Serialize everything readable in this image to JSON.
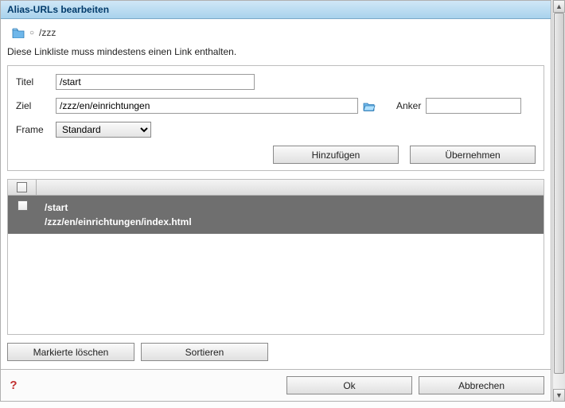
{
  "dialog": {
    "title": "Alias-URLs bearbeiten"
  },
  "breadcrumb": {
    "path": "/zzz"
  },
  "message": "Diese Linkliste muss mindestens einen Link enthalten.",
  "form": {
    "labels": {
      "titel": "Titel",
      "ziel": "Ziel",
      "anker": "Anker",
      "frame": "Frame"
    },
    "values": {
      "titel": "/start",
      "ziel": "/zzz/en/einrichtungen",
      "anker": "",
      "frame": "Standard"
    },
    "buttons": {
      "hinzufuegen": "Hinzufügen",
      "uebernehmen": "Übernehmen"
    }
  },
  "list": {
    "items": [
      {
        "title": "/start",
        "path": "/zzz/en/einrichtungen/index.html"
      }
    ]
  },
  "below": {
    "delete": "Markierte löschen",
    "sort": "Sortieren"
  },
  "footer": {
    "ok": "Ok",
    "cancel": "Abbrechen"
  }
}
